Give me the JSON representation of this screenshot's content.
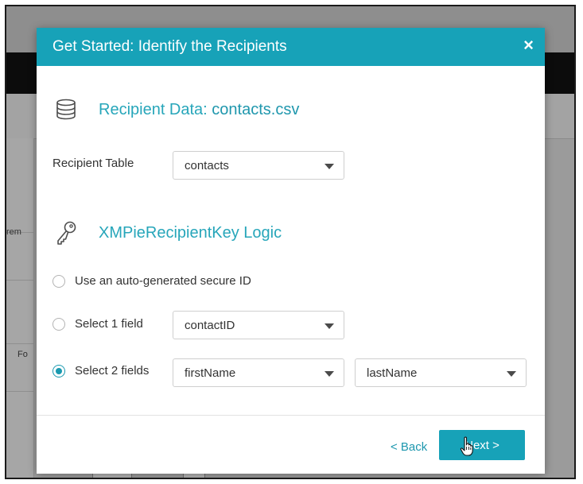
{
  "background": {
    "side_fragment_1": "rem",
    "side_fragment_2": "Fo"
  },
  "modal": {
    "title": "Get Started: Identify the Recipients",
    "close_label": "×",
    "recipient_section": {
      "icon": "database-icon",
      "heading_prefix": "Recipient Data: ",
      "heading_file": "contacts.csv",
      "table_label": "Recipient Table",
      "table_value": "contacts"
    },
    "key_section": {
      "icon": "key-icon",
      "heading": "XMPieRecipientKey Logic",
      "options": [
        {
          "label": "Use an auto-generated secure ID",
          "selected": false
        },
        {
          "label": "Select 1 field",
          "selected": false,
          "field_1": "contactID"
        },
        {
          "label": "Select 2 fields",
          "selected": true,
          "field_1": "firstName",
          "field_2": "lastName"
        }
      ]
    },
    "footer": {
      "back_label": "< Back",
      "next_label": "Next >"
    }
  },
  "colors": {
    "accent": "#17a2b8",
    "heading_text": "#27a6ba"
  }
}
